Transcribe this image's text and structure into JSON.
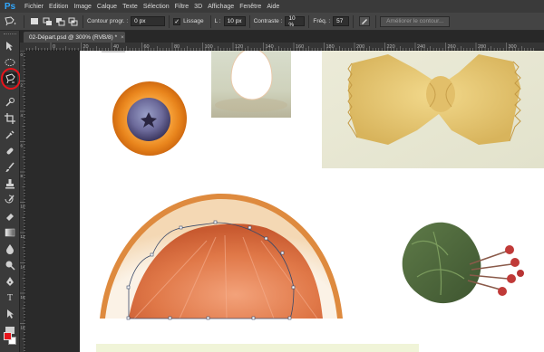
{
  "app": {
    "logo": "Ps"
  },
  "menu": [
    "Fichier",
    "Edition",
    "Image",
    "Calque",
    "Texte",
    "Sélection",
    "Filtre",
    "3D",
    "Affichage",
    "Fenêtre",
    "Aide"
  ],
  "options": {
    "feather_label": "Contour progr. :",
    "feather_value": "0 px",
    "smooth_label": "Lissage",
    "width_label": "L :",
    "width_value": "10 px",
    "contrast_label": "Contraste :",
    "contrast_value": "10 %",
    "freq_label": "Fréq. :",
    "freq_value": "57",
    "refine_button": "Améliorer le contour..."
  },
  "document": {
    "tab_label": "02-Départ.psd @ 300% (RVB/8) *",
    "close": "×"
  },
  "ruler": {
    "top_ticks": [
      "20",
      "0",
      "20",
      "40",
      "60",
      "80",
      "100",
      "120",
      "140",
      "160",
      "180",
      "200",
      "220",
      "240",
      "260",
      "280",
      "300"
    ],
    "left_ticks": [
      "0",
      "2",
      "4",
      "6",
      "8",
      "10",
      "12",
      "14",
      "16",
      "18",
      "20"
    ]
  },
  "colors": {
    "accent": "#31a8ff",
    "annotation": "#e8141b",
    "foreground": "#e8141b",
    "background": "#ffffff",
    "path": "#3a4a6a"
  },
  "tools": [
    "move-tool-icon",
    "marquee-tool-icon",
    "magnetic-lasso-tool-icon",
    "quick-select-tool-icon",
    "crop-tool-icon",
    "eyedropper-tool-icon",
    "healing-tool-icon",
    "brush-tool-icon",
    "clone-stamp-tool-icon",
    "history-brush-tool-icon",
    "eraser-tool-icon",
    "gradient-tool-icon",
    "blur-tool-icon",
    "dodge-tool-icon",
    "pen-tool-icon",
    "type-tool-icon",
    "path-select-tool-icon",
    "rectangle-tool-icon",
    "hand-tool-icon",
    "zoom-tool-icon"
  ]
}
